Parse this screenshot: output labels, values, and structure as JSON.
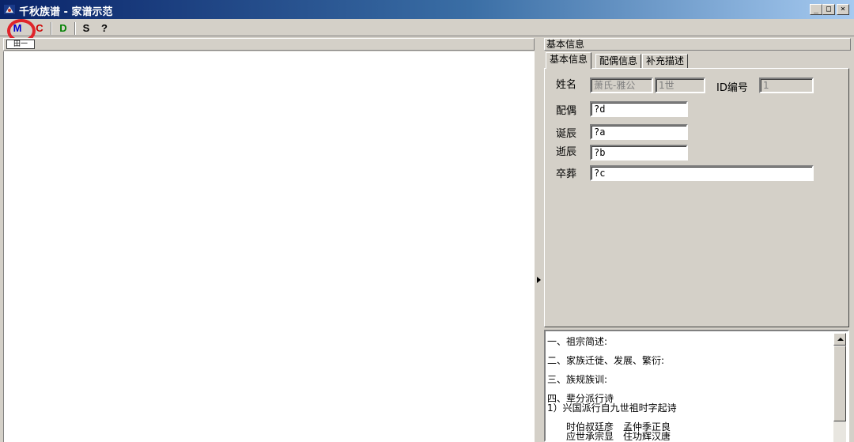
{
  "window": {
    "title": "千秋族谱 - 家谱示范",
    "controls": {
      "minimize": "_",
      "maximize": "□",
      "close": "×"
    }
  },
  "toolbar": {
    "buttons": [
      {
        "label": "M",
        "color": "#0000cc"
      },
      {
        "label": "C",
        "color": "#cc0000"
      },
      {
        "label": "D",
        "color": "#008000"
      },
      {
        "label": "S",
        "color": "#000000"
      },
      {
        "label": "?",
        "color": "#000000"
      }
    ]
  },
  "left_pane": {
    "tree_root_label": "田一"
  },
  "right_pane": {
    "header": "基本信息",
    "tabs": [
      "基本信息",
      "配偶信息",
      "补充描述"
    ],
    "form": {
      "name_label": "姓名",
      "name_value": "萧氏-雅公",
      "generation_value": "1世",
      "id_label": "ID编号",
      "id_value": "1",
      "spouse_label": "配偶",
      "spouse_value": "?d",
      "birth_label": "诞辰",
      "birth_value": "?a",
      "death_label": "逝辰",
      "death_value": "?b",
      "burial_label": "卒葬",
      "burial_value": "?c"
    },
    "memo": {
      "lines": [
        "一、祖宗简述:",
        "二、家族迁徙、发展、繁衍:",
        "三、族规族训:",
        "四、辈分派行诗",
        "1）兴国派行自九世祖时字起诗",
        "时伯叔廷彦　孟仲季正良",
        "应世承宗显　住功辉汉唐"
      ]
    }
  },
  "colors": {
    "highlight_circle": "#e0242a",
    "titlebar": "#0a246a"
  }
}
